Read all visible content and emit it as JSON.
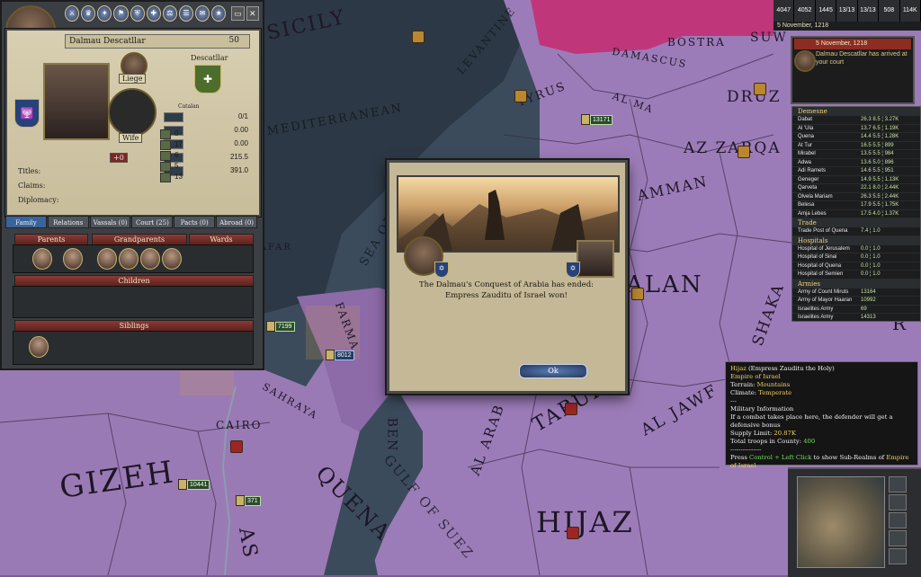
{
  "character": {
    "name": "Dalmau Descatllar",
    "age": "50",
    "dynasty": "Descatllar",
    "liege_label": "Liege",
    "wife_label": "Wife",
    "titles_label": "Titles:",
    "claims_label": "Claims:",
    "diplomacy_label": "Diplomacy:",
    "culture_label": "Catalan",
    "stats": [
      {
        "label": "",
        "value": "0/1"
      },
      {
        "label": "",
        "value": "0.00"
      },
      {
        "label": "",
        "value": "0.00"
      },
      {
        "label": "",
        "value": "215.5"
      },
      {
        "label": "",
        "value": "391.0"
      }
    ],
    "skills": [
      "0",
      "17",
      "6",
      "5",
      "13"
    ],
    "small_number": "+0"
  },
  "tabs": [
    {
      "label": "Family"
    },
    {
      "label": "Relations"
    },
    {
      "label": "Vassals",
      "count": "(0)"
    },
    {
      "label": "Court",
      "count": "(25)"
    },
    {
      "label": "Pacts",
      "count": "(0)"
    },
    {
      "label": "Abroad",
      "count": "(0)"
    }
  ],
  "family": {
    "parents": "Parents",
    "grandparents": "Grandparents",
    "wards": "Wards",
    "children": "Children",
    "siblings": "Siblings"
  },
  "event": {
    "text": "The Dalmau's Conquest of Arabia has ended: Empress Zauditu of Israel won!",
    "ok_label": "Ok"
  },
  "resources": [
    "4047",
    "4052",
    "1445",
    "13/13",
    "13/13",
    "508",
    "114K"
  ],
  "date": "5 November, 1218",
  "message": {
    "date": "5 November, 1218",
    "body": "Dalmau Descatllar has arrived at your court"
  },
  "ledger": {
    "demesne_head": "Demesne",
    "demesne": [
      {
        "name": "Dabat",
        "vals": "26.3 8.5 ¦ 3.27K"
      },
      {
        "name": "Al 'Ula",
        "vals": "13.7 6.5 ¦ 1.19K"
      },
      {
        "name": "Quena",
        "vals": "14.4 5.5 ¦ 1.28K"
      },
      {
        "name": "At Tur",
        "vals": "16.5 5.5 ¦ 899"
      },
      {
        "name": "Mirabel",
        "vals": "13.5 5.5 ¦ 984"
      },
      {
        "name": "Adwa",
        "vals": "13.6 5.0 ¦ 896"
      },
      {
        "name": "Adi Ramets",
        "vals": "14.6 5.5 ¦ 951"
      },
      {
        "name": "Geneger",
        "vals": "14.9 5.5 ¦ 1.13K"
      },
      {
        "name": "Qarveta",
        "vals": "22.1 8.0 ¦ 2.44K"
      },
      {
        "name": "Olvela Mariam",
        "vals": "26.3 5.5 ¦ 2.44K"
      },
      {
        "name": "Belesa",
        "vals": "17.9 5.5 ¦ 1.75K"
      },
      {
        "name": "Amja Lebes",
        "vals": "17.5 4.0 ¦ 1.37K"
      }
    ],
    "trade_head": "Trade",
    "trade": [
      {
        "name": "Trade Post of Quena",
        "vals": "7.4 ¦ 1.0"
      }
    ],
    "hospitals_head": "Hospitals",
    "hospitals": [
      {
        "name": "Hospital of Jerusalem",
        "vals": "0.0 ¦ 1.0"
      },
      {
        "name": "Hospital of Sinai",
        "vals": "0.0 ¦ 1.0"
      },
      {
        "name": "Hospital of Quena",
        "vals": "0.0 ¦ 1.0"
      },
      {
        "name": "Hospital of Semien",
        "vals": "0.0 ¦ 1.0"
      }
    ],
    "armies_head": "Armies",
    "armies": [
      {
        "name": "Army of Count Miruts",
        "vals": "13164"
      },
      {
        "name": "Army of Mayor Haaran",
        "vals": "10992"
      },
      {
        "name": "Israelites Army",
        "vals": "69"
      },
      {
        "name": "Israelites Army",
        "vals": "14313"
      },
      {
        "name": "Israelites Army",
        "vals": "10440"
      }
    ]
  },
  "tooltip": {
    "province": "Hijaz",
    "ruler": "(Empress Zauditu the Holy)",
    "realm": "Empire of Israel",
    "terrain_label": "Terrain:",
    "terrain": "Mountains",
    "climate_label": "Climate:",
    "climate": "Temperate",
    "sep1": "---",
    "military_head": "Military Information",
    "defense": "If a combat takes place here, the defender will get a defensive bonus",
    "supply_label": "Supply Limit:",
    "supply": "20.87K",
    "troops_label": "Total troops in County:",
    "troops": "400",
    "sep2": "---------------",
    "hint_prefix": "Press",
    "hint_key": "Control + Left Click",
    "hint_mid": "to show Sub-Realms of",
    "hint_realm": "Empire of Israel"
  },
  "map": {
    "labels": [
      "SICILY",
      "LEVANTINE",
      "DAMASCUS",
      "BOSTRA",
      "SUW",
      "TYRUS",
      "AL MA",
      "DRUZ",
      "AZ ZARQA",
      "AMMAN",
      "MEDITERRANEAN",
      "SEA OF",
      "ALAN",
      "SHAKA",
      "FARMA",
      "SAFAR",
      "SAHRAYA",
      "CAIRO",
      "GIZEH",
      "QUENA",
      "GULF OF SUEZ",
      "TABUK",
      "AL JAWF",
      "HIJAZ",
      "AL ARAB",
      "BEN",
      "R",
      "AS"
    ],
    "armies": [
      "13171",
      "7199",
      "8012",
      "10441",
      "371"
    ]
  },
  "colors": {
    "empire": "#9b7bb7",
    "sea": "#3a4d63",
    "accent_red": "#8c2c22",
    "text_gold": "#f0d060"
  }
}
